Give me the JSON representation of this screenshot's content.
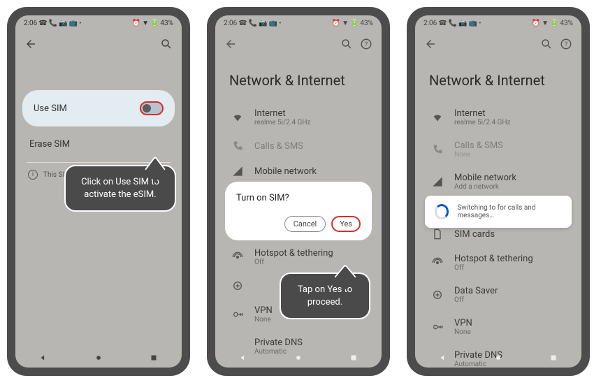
{
  "status": {
    "time": "2:06",
    "battery": "43%"
  },
  "screen1": {
    "useSimLabel": "Use SIM",
    "eraseLabel": "Erase SIM",
    "infoText": "This SIM is",
    "callout": "Click on Use SIM to activate the eSIM."
  },
  "pageTitle": "Network & Internet",
  "rows": {
    "internet": {
      "label": "Internet",
      "sub": "realme 5i/2.4 GHz"
    },
    "callsSms": {
      "label": "Calls & SMS",
      "sub": ""
    },
    "mobileNet": {
      "label": "Mobile network",
      "sub": "Add a network"
    },
    "mobileNetSub2": "None",
    "simCards": {
      "label": "SIM cards"
    },
    "hotspot": {
      "label": "Hotspot & tethering",
      "sub": "Off"
    },
    "dataSaver": {
      "label": "Data Saver",
      "sub": "Off"
    },
    "vpn": {
      "label": "VPN",
      "sub": "None"
    },
    "privateDns": {
      "label": "Private DNS",
      "sub": "Automatic"
    }
  },
  "dialog": {
    "title": "Turn on SIM?",
    "cancel": "Cancel",
    "yes": "Yes",
    "callout": "Tap on Yes to proceed."
  },
  "toast": {
    "text": "Switching to  for calls and messages…"
  }
}
